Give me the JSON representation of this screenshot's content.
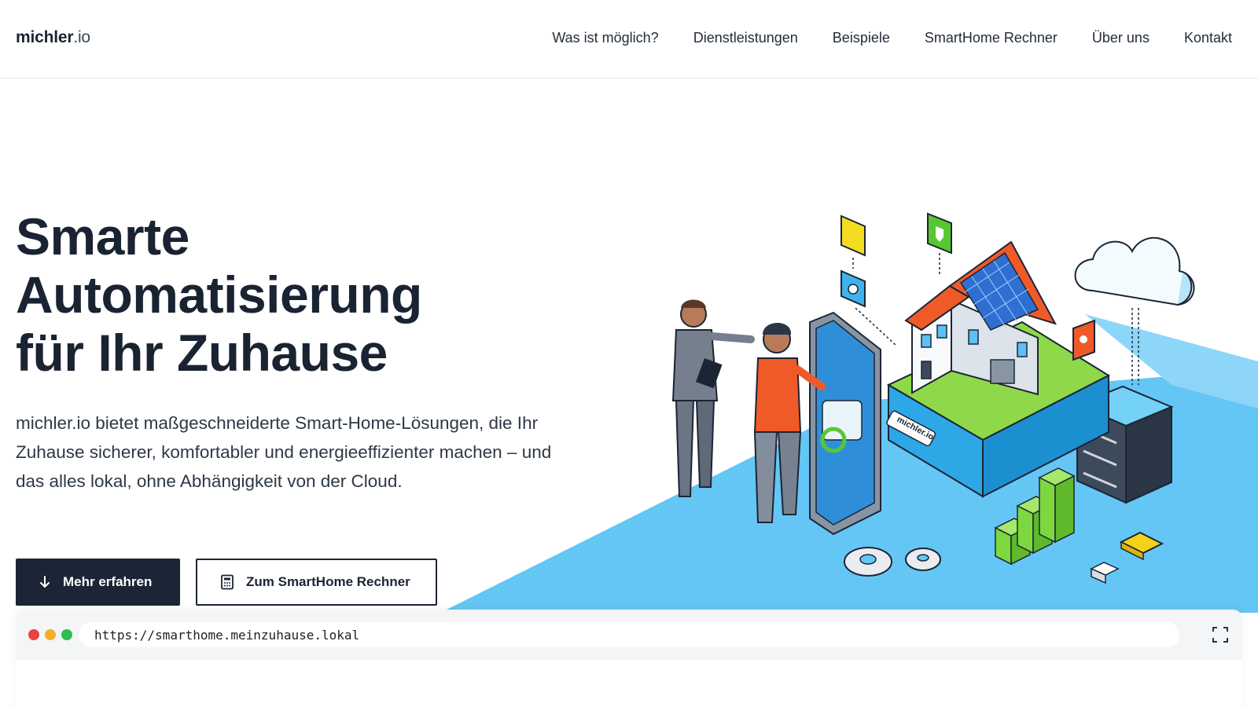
{
  "nav": {
    "logo_main": "michler",
    "logo_tld": ".io",
    "links": [
      "Was ist möglich?",
      "Dienstleistungen",
      "Beispiele",
      "SmartHome Rechner",
      "Über uns",
      "Kontakt"
    ]
  },
  "hero": {
    "title_line1": "Smarte",
    "title_line2": "Automatisierung",
    "title_line3": "für Ihr Zuhause",
    "description": "michler.io bietet maßgeschneiderte Smart-Home-Lösungen, die Ihr Zuhause sicherer, komfortabler und energieeffizienter machen – und das alles lokal, ohne Abhängigkeit von der Cloud.",
    "primary_button": "Mehr erfahren",
    "secondary_button": "Zum SmartHome Rechner"
  },
  "illustration": {
    "badge_text": "michler.io"
  },
  "browser": {
    "url": "https://smarthome.meinzuhause.lokal",
    "dot_colors": [
      "#e8433f",
      "#f2b125",
      "#2dbd4e"
    ]
  },
  "colors": {
    "dark": "#1b2535",
    "floor_blue": "#64c6f5",
    "roof_orange": "#f05a28",
    "green": "#7dd83f"
  }
}
